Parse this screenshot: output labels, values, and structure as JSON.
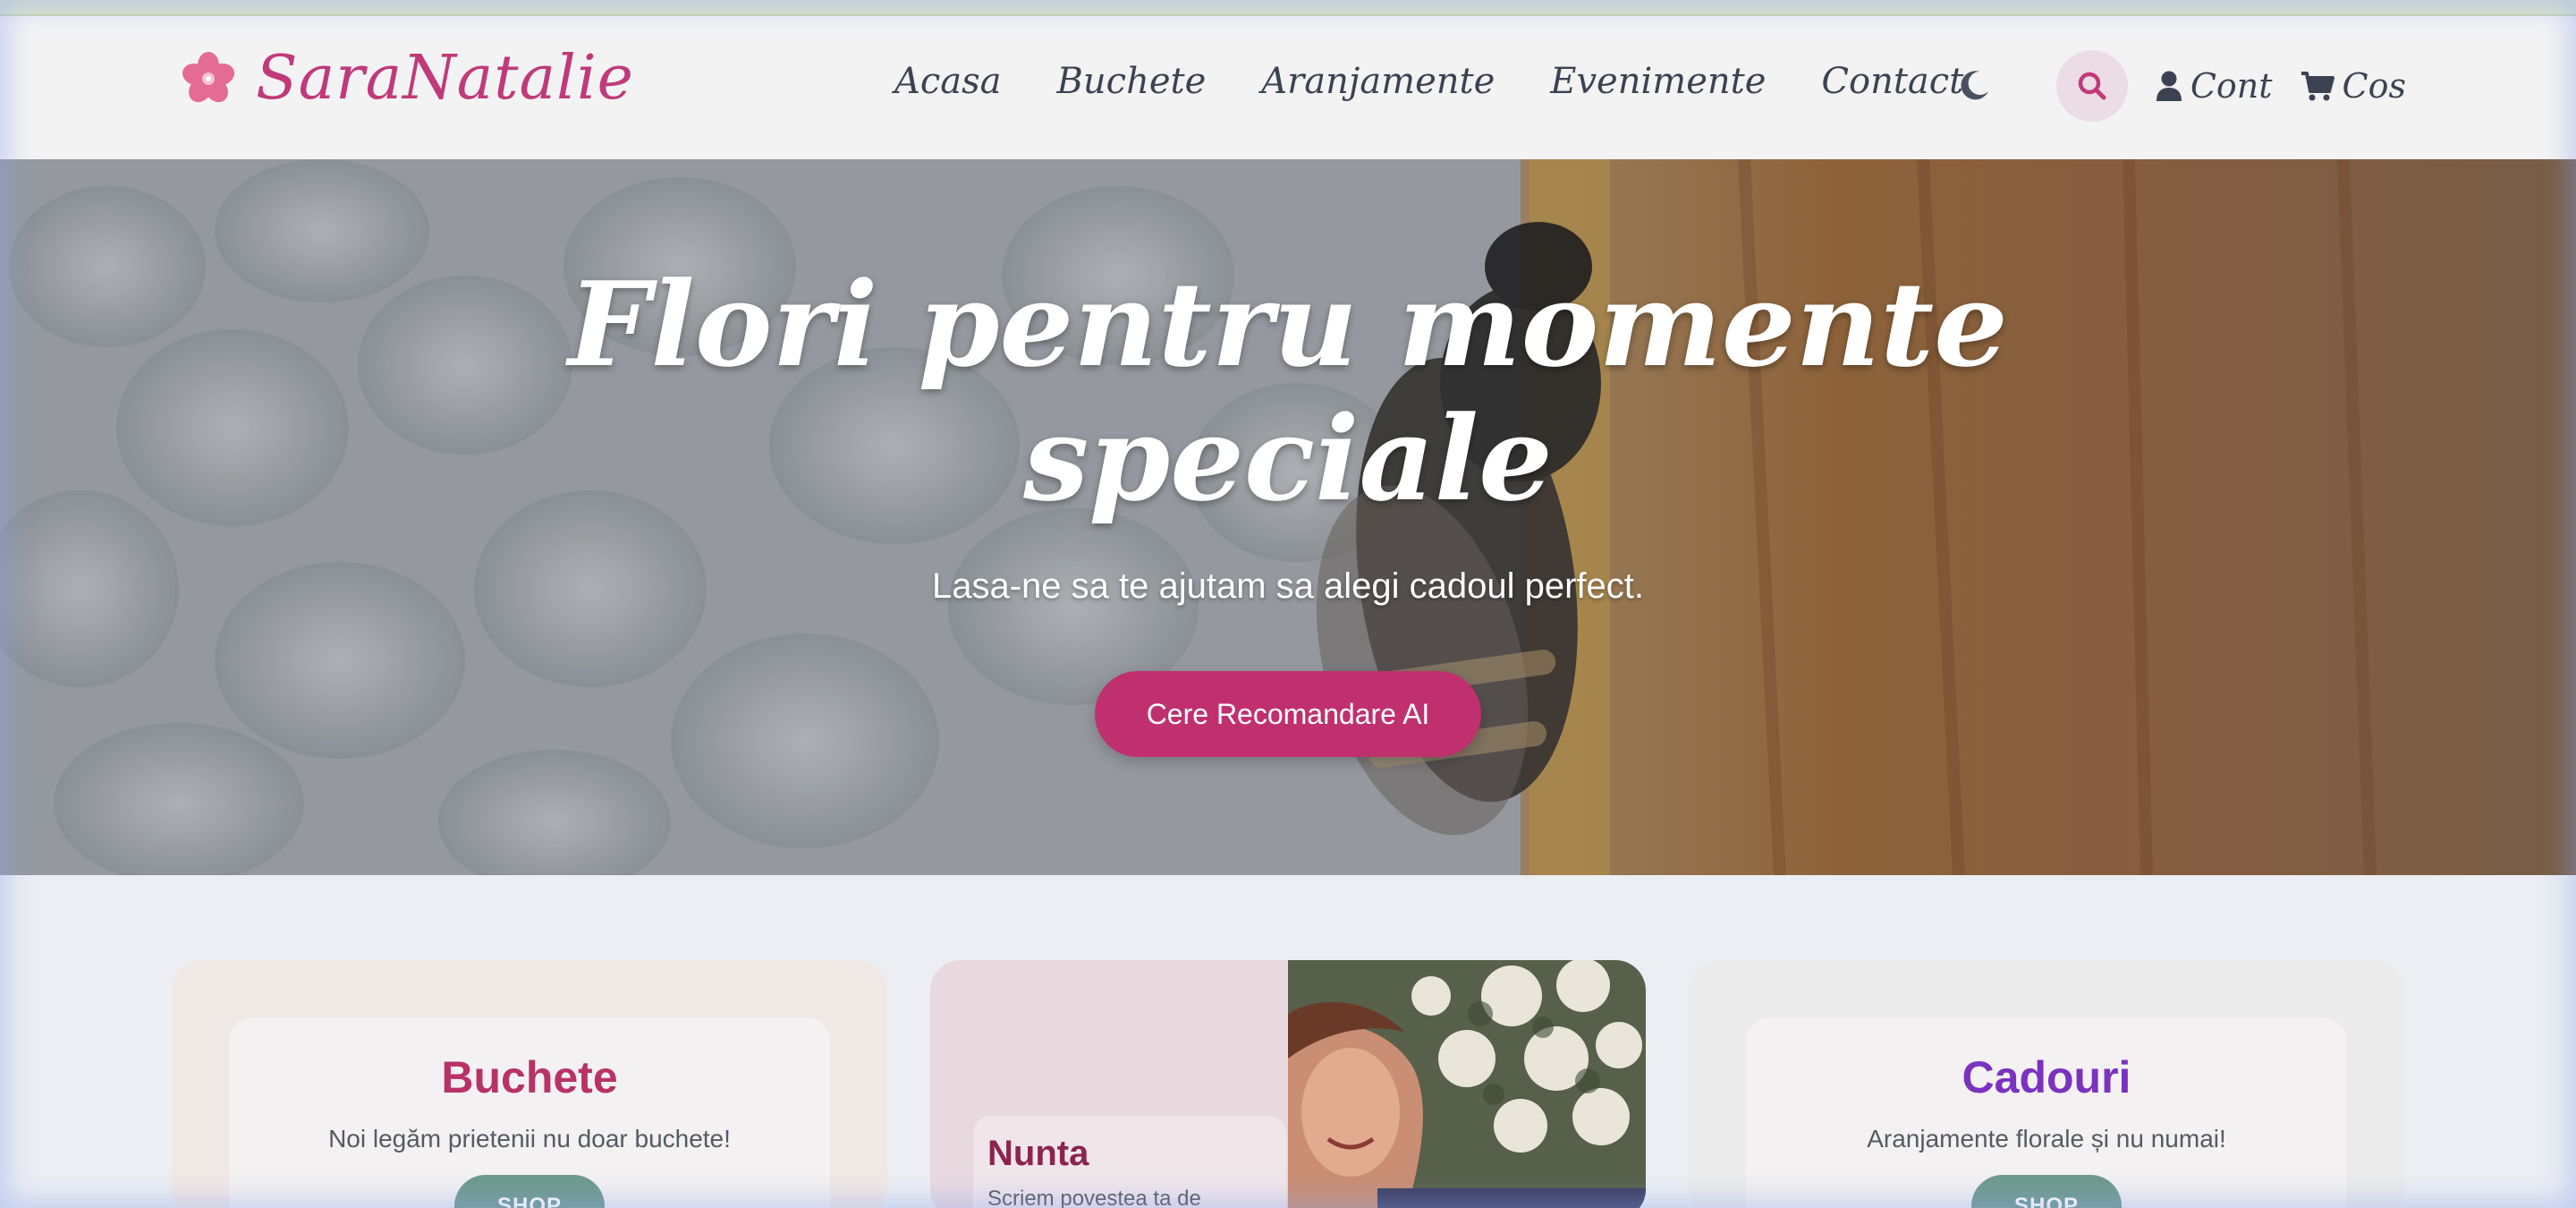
{
  "brand": {
    "name": "SaraNatalie"
  },
  "nav": {
    "items": [
      {
        "label": "Acasa"
      },
      {
        "label": "Buchete"
      },
      {
        "label": "Aranjamente"
      },
      {
        "label": "Evenimente"
      },
      {
        "label": "Contact"
      }
    ]
  },
  "actions": {
    "account_label": "Cont",
    "cart_label": "Cos"
  },
  "hero": {
    "title_line1": "Flori pentru momente",
    "title_line2": "speciale",
    "subtitle": "Lasa-ne sa te ajutam sa alegi cadoul perfect.",
    "cta_label": "Cere Recomandare AI"
  },
  "cards": {
    "left": {
      "title": "Buchete",
      "description": "Noi legăm prietenii nu doar buchete!",
      "button": "SHOP"
    },
    "middle": {
      "title": "Nunta",
      "description": "Scriem povestea ta de"
    },
    "right": {
      "title": "Cadouri",
      "description": "Aranjamente florale și nu numai!",
      "button": "SHOP"
    }
  },
  "colors": {
    "brand": "#c03a7a",
    "cta": "#c0306f",
    "buchete_title": "#b83268",
    "cadouri_title": "#7b32c0",
    "shop_button": "#6f9a8e"
  },
  "icons": [
    "flower-logo-icon",
    "moon-icon",
    "search-icon",
    "user-icon",
    "cart-icon"
  ]
}
